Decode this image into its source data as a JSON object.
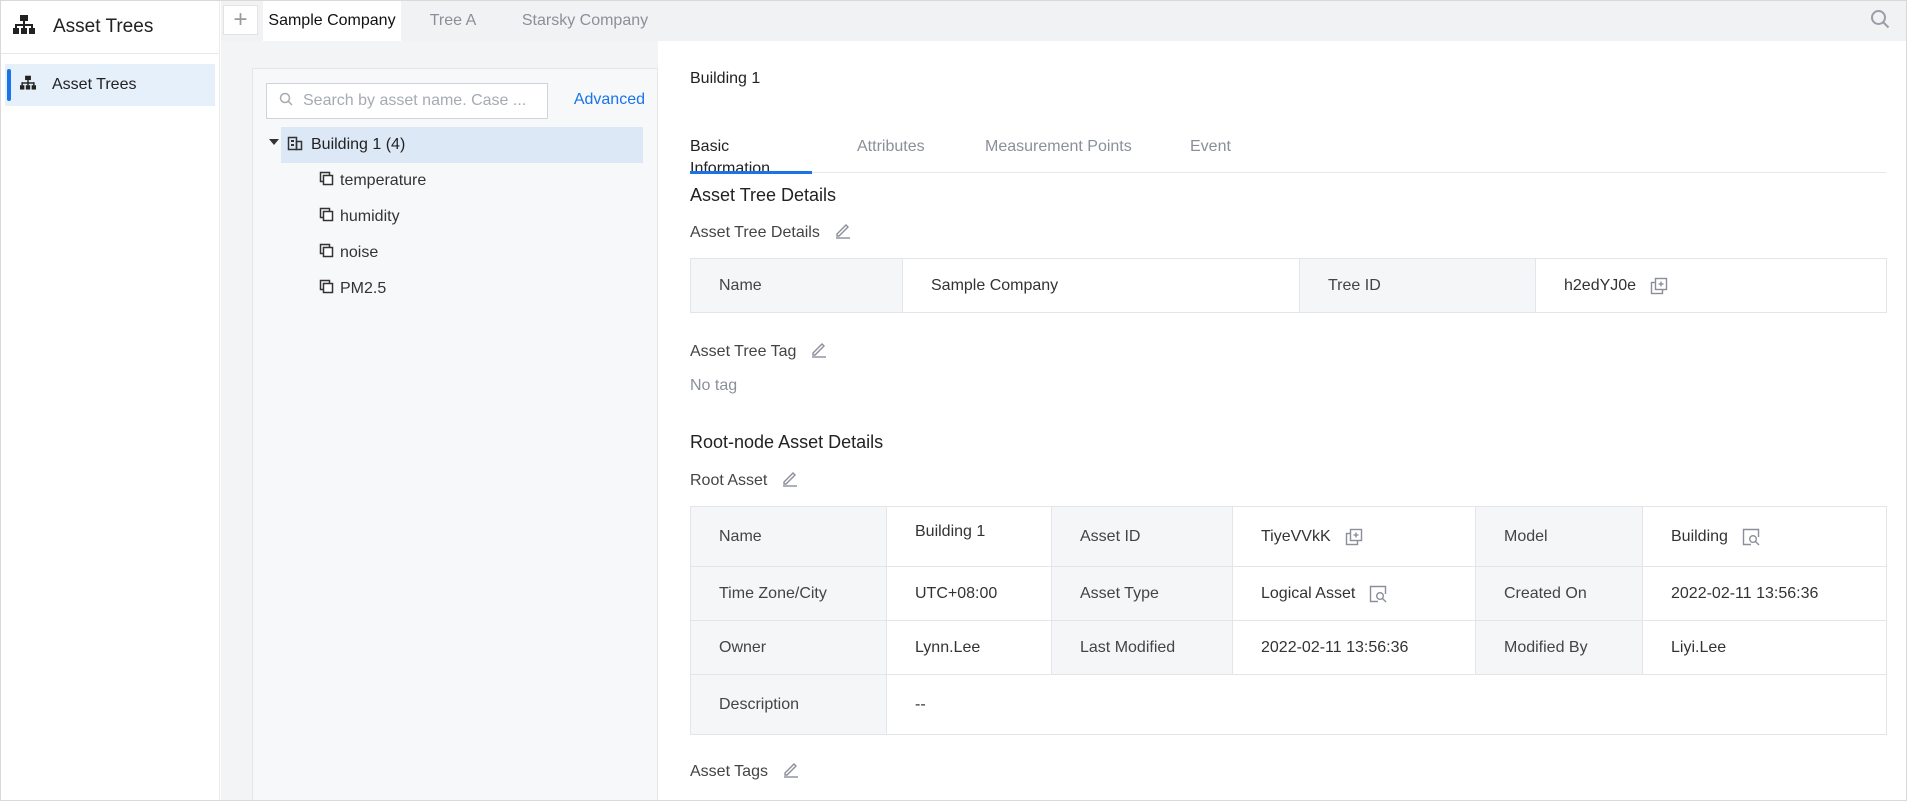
{
  "app": {
    "title": "Asset Trees"
  },
  "nav": {
    "items": [
      {
        "label": "Asset Trees"
      }
    ]
  },
  "top_tabs": [
    {
      "label": "Sample Company"
    },
    {
      "label": "Tree A"
    },
    {
      "label": "Starsky Company"
    }
  ],
  "tree": {
    "search_placeholder": "Search by asset name. Case ...",
    "advanced_label": "Advanced",
    "root": {
      "label": "Building 1 (4)"
    },
    "children": [
      {
        "label": "temperature"
      },
      {
        "label": "humidity"
      },
      {
        "label": "noise"
      },
      {
        "label": "PM2.5"
      }
    ]
  },
  "detail": {
    "breadcrumb": "Building 1",
    "tabs": [
      {
        "label": "Basic Information"
      },
      {
        "label": "Attributes"
      },
      {
        "label": "Measurement Points"
      },
      {
        "label": "Event"
      }
    ],
    "asset_tree_section": {
      "heading": "Asset Tree Details",
      "subheading": "Asset Tree Details",
      "name_label": "Name",
      "name_value": "Sample Company",
      "tree_id_label": "Tree ID",
      "tree_id_value": "h2edYJ0e",
      "tag_heading": "Asset Tree Tag",
      "tag_value": "No tag"
    },
    "root_section": {
      "heading": "Root-node Asset Details",
      "subheading": "Root Asset",
      "rows": {
        "name_label": "Name",
        "name_value": "Building 1",
        "asset_id_label": "Asset ID",
        "asset_id_value": "TiyeVVkK",
        "model_label": "Model",
        "model_value": "Building",
        "tz_label": "Time Zone/City",
        "tz_value": "UTC+08:00",
        "type_label": "Asset Type",
        "type_value": "Logical Asset",
        "created_label": "Created On",
        "created_value": "2022-02-11 13:56:36",
        "owner_label": "Owner",
        "owner_value": "Lynn.Lee",
        "modified_label": "Last Modified",
        "modified_value": "2022-02-11 13:56:36",
        "modified_by_label": "Modified By",
        "modified_by_value": "Liyi.Lee",
        "desc_label": "Description",
        "desc_value": "--"
      },
      "asset_tags_heading": "Asset Tags"
    }
  },
  "colors": {
    "accent": "#1a73e8",
    "selected_bg": "#dde8f7",
    "nav_selected_bg": "#e6f0fb"
  }
}
